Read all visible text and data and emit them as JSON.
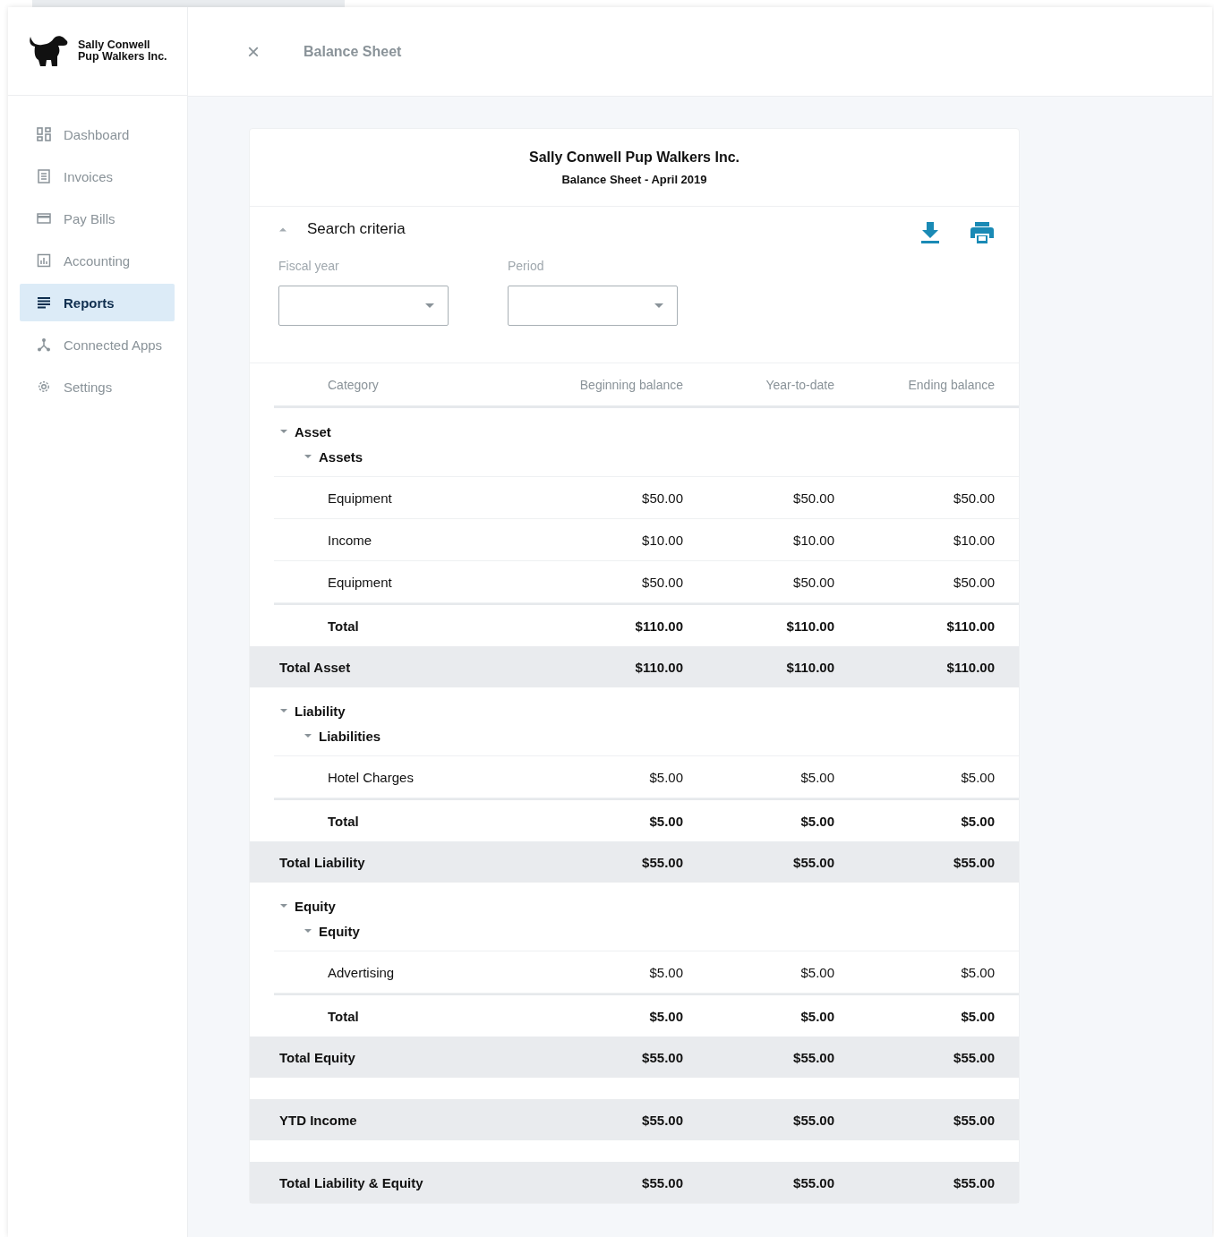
{
  "company": {
    "line1": "Sally Conwell",
    "line2": "Pup Walkers Inc."
  },
  "nav": [
    {
      "label": "Dashboard",
      "selected": false
    },
    {
      "label": "Invoices",
      "selected": false
    },
    {
      "label": "Pay Bills",
      "selected": false
    },
    {
      "label": "Accounting",
      "selected": false
    },
    {
      "label": "Reports",
      "selected": true
    },
    {
      "label": "Connected Apps",
      "selected": false
    },
    {
      "label": "Settings",
      "selected": false
    }
  ],
  "header": {
    "close": "×",
    "title": "Balance Sheet"
  },
  "report": {
    "title": "Sally Conwell Pup Walkers Inc.",
    "subtitle": "Balance Sheet - April 2019"
  },
  "search": {
    "title": "Search criteria",
    "expanded": true,
    "fields": [
      {
        "label": "Fiscal year"
      },
      {
        "label": "Period"
      }
    ]
  },
  "columns": [
    "Category",
    "Beginning balance",
    "Year-to-date",
    "Ending balance"
  ],
  "sections": [
    {
      "name": "Asset",
      "expanded": true,
      "groups": [
        {
          "name": "Assets",
          "expanded": true,
          "rows": [
            {
              "category": "Equipment",
              "values": [
                "$50.00",
                "$50.00",
                "$50.00"
              ]
            },
            {
              "category": "Income",
              "values": [
                "$10.00",
                "$10.00",
                "$10.00"
              ]
            },
            {
              "category": "Equipment",
              "values": [
                "$50.00",
                "$50.00",
                "$50.00"
              ]
            }
          ],
          "total": {
            "label": "Total",
            "values": [
              "$110.00",
              "$110.00",
              "$110.00"
            ]
          }
        }
      ],
      "total": {
        "label": "Total Asset",
        "values": [
          "$110.00",
          "$110.00",
          "$110.00"
        ]
      }
    },
    {
      "name": "Liability",
      "expanded": true,
      "groups": [
        {
          "name": "Liabilities",
          "expanded": true,
          "rows": [
            {
              "category": "Hotel Charges",
              "values": [
                "$5.00",
                "$5.00",
                "$5.00"
              ]
            }
          ],
          "total": {
            "label": "Total",
            "values": [
              "$5.00",
              "$5.00",
              "$5.00"
            ]
          }
        }
      ],
      "total": {
        "label": "Total Liability",
        "values": [
          "$55.00",
          "$55.00",
          "$55.00"
        ]
      }
    },
    {
      "name": "Equity",
      "expanded": true,
      "groups": [
        {
          "name": "Equity",
          "expanded": true,
          "rows": [
            {
              "category": "Advertising",
              "values": [
                "$5.00",
                "$5.00",
                "$5.00"
              ]
            }
          ],
          "total": {
            "label": "Total",
            "values": [
              "$5.00",
              "$5.00",
              "$5.00"
            ]
          }
        }
      ],
      "total": {
        "label": "Total Equity",
        "values": [
          "$55.00",
          "$55.00",
          "$55.00"
        ]
      }
    }
  ],
  "summary": [
    {
      "label": "YTD Income",
      "values": [
        "$55.00",
        "$55.00",
        "$55.00"
      ]
    },
    {
      "label": "Total Liability & Equity",
      "values": [
        "$55.00",
        "$55.00",
        "$55.00"
      ]
    }
  ]
}
